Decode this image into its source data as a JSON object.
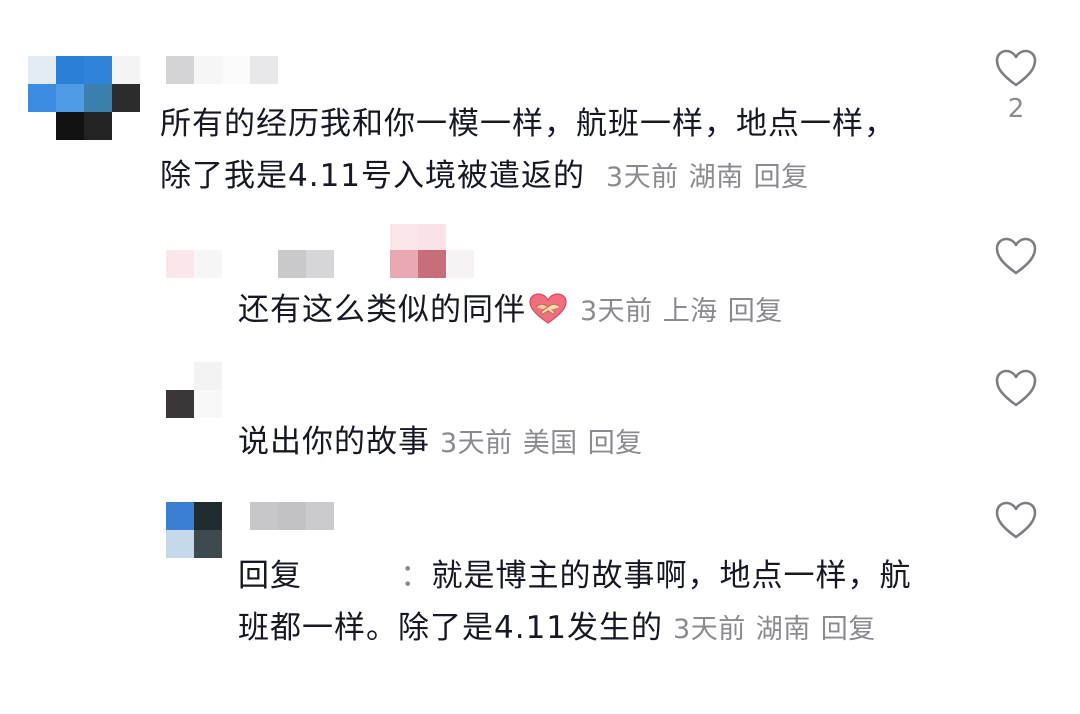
{
  "comments": [
    {
      "content": "所有的经历我和你一模一样，航班一样，地点一样，",
      "content_line2": "除了我是4.11号入境被遣返的",
      "time": "3天前",
      "location": "湖南",
      "reply_label": "回复",
      "like_count": "2",
      "like_icon": "heart-outline-icon"
    },
    {
      "content": "还有这么类似的同伴",
      "emoji": "handshake-heart-emoji",
      "time": "3天前",
      "location": "上海",
      "reply_label": "回复",
      "like_icon": "heart-outline-icon"
    },
    {
      "content": "说出你的故事",
      "time": "3天前",
      "location": "美国",
      "reply_label": "回复",
      "like_icon": "heart-outline-icon"
    },
    {
      "reply_prefix": "回复",
      "reply_colon": "：",
      "content": "就是博主的故事啊，地点一样，航",
      "content_line2": "班都一样。除了是4.11发生的",
      "time": "3天前",
      "location": "湖南",
      "reply_label": "回复",
      "like_icon": "heart-outline-icon"
    }
  ],
  "colors": {
    "text": "#161823",
    "meta": "#8a8b91",
    "heart_stroke": "#7d7e85",
    "mosaic_blue": "#3b83d6",
    "mosaic_dark": "#2b2b2b",
    "mosaic_pink": "#c86e7b"
  }
}
